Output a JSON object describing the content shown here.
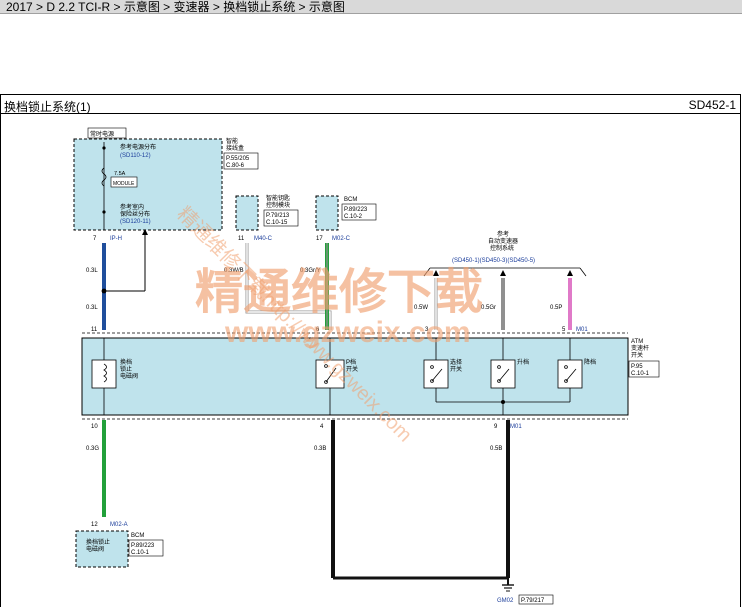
{
  "breadcrumb": "2017 > D 2.2 TCI-R > 示意图 > 变速器 > 换档锁止系统 > 示意图",
  "diagram": {
    "title": "换档锁止系统(1)",
    "code": "SD452-1",
    "power_box": {
      "header": "常时电源",
      "ref1": "参考电源分布",
      "ref1_code": "(SD110-12)",
      "fuse_rating": "7.5A",
      "fuse_label": "MODULE",
      "ref2": "参考室内",
      "ref2b": "保险丝分布",
      "ref2_code": "(SD120-11)",
      "side_name1": "智能",
      "side_name2": "接线盒",
      "side_page": "P.55/205",
      "side_conn": "C.80-6"
    },
    "smart_key": {
      "name1": "智能钥匙",
      "name2": "控制模块",
      "page": "P.79/213",
      "conn": "C.10-15"
    },
    "bcm_top": {
      "name": "BCM",
      "page": "P.89/223",
      "conn": "C.10-2"
    },
    "tcm_ref": {
      "line1": "参考",
      "line2": "自动变速器",
      "line3": "控制系统",
      "codes": "(SD450-1)(SD450-3)(SD450-5)"
    },
    "atm": {
      "name1": "ATM",
      "name2": "变速杆",
      "name3": "开关",
      "page": "P.95",
      "conn": "C.10-1",
      "solenoid1": "换档",
      "solenoid2": "锁止",
      "solenoid3": "电磁阀",
      "p_switch1": "P档",
      "p_switch2": "开关",
      "select1": "选择",
      "select2": "开关",
      "up": "升档",
      "down": "降档"
    },
    "bcm_bottom": {
      "name1": "换档锁止",
      "name2": "电磁阀",
      "bcm": "BCM",
      "page": "P.89/223",
      "conn": "C.10-1"
    },
    "pins": {
      "p7": "7",
      "p7_conn": "IP-H",
      "p11_top": "11",
      "p11_top_conn": "M40-C",
      "p17": "17",
      "p17_conn": "M02-C",
      "p11": "11",
      "p6": "6",
      "p3": "3",
      "p5": "5",
      "p5_conn": "M01",
      "p10": "10",
      "p4": "4",
      "p9": "9",
      "p9_conn": "M01",
      "p12": "12",
      "p12_conn": "M02-A"
    },
    "wires": {
      "w_03l_a": "0.3L",
      "w_03l_b": "0.3L",
      "w_03w_b": "0.3W/B",
      "w_03gr": "0.3Gr/Y",
      "w_05w": "0.5W",
      "w_05gr": "0.5Gr",
      "w_05p": "0.5P",
      "w_03g": "0.3G",
      "w_03b": "0.3B",
      "w_05b": "0.5B"
    },
    "ground": {
      "name": "GM02",
      "page": "P.79/217"
    },
    "colors": {
      "blue": "#1f4e9c",
      "green": "#22a03a",
      "pink": "#e07ac8",
      "grey": "#909090",
      "black": "#111111",
      "box": "#bfe3ec",
      "ref_blue": "#1a3c9a"
    }
  },
  "watermark": {
    "big": "精通维修下载",
    "url": "www.gzweix.com",
    "diag": "精通维修下载http://www.gzweix.com"
  }
}
